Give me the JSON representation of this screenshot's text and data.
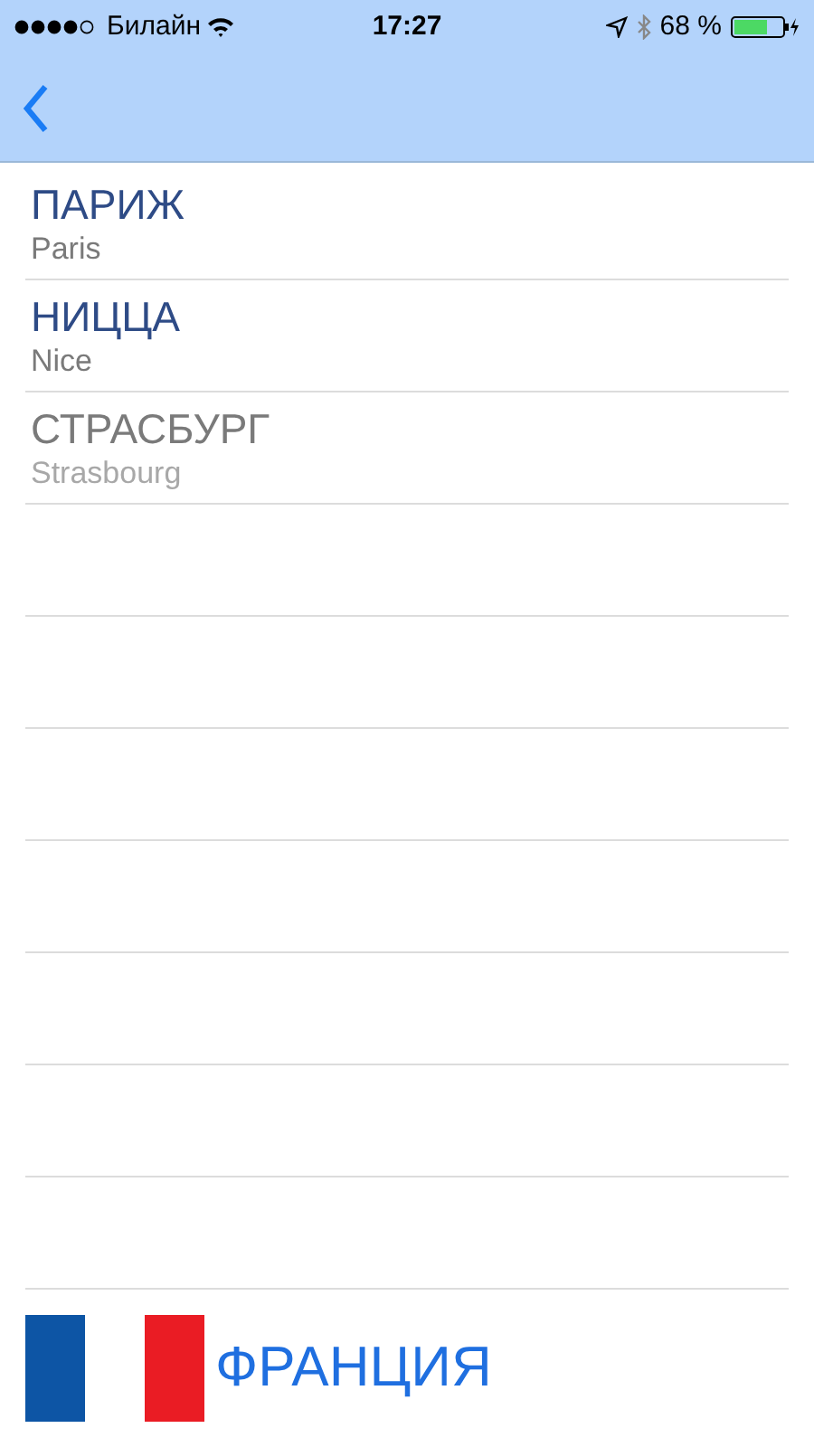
{
  "status_bar": {
    "carrier": "Билайн",
    "time": "17:27",
    "battery_percent": "68 %"
  },
  "cities": [
    {
      "name": "ПАРИЖ",
      "subtitle": "Paris",
      "disabled": false
    },
    {
      "name": "НИЦЦА",
      "subtitle": "Nice",
      "disabled": false
    },
    {
      "name": "СТРАСБУРГ",
      "subtitle": "Strasbourg",
      "disabled": true
    }
  ],
  "country": {
    "name": "ФРАНЦИЯ"
  }
}
